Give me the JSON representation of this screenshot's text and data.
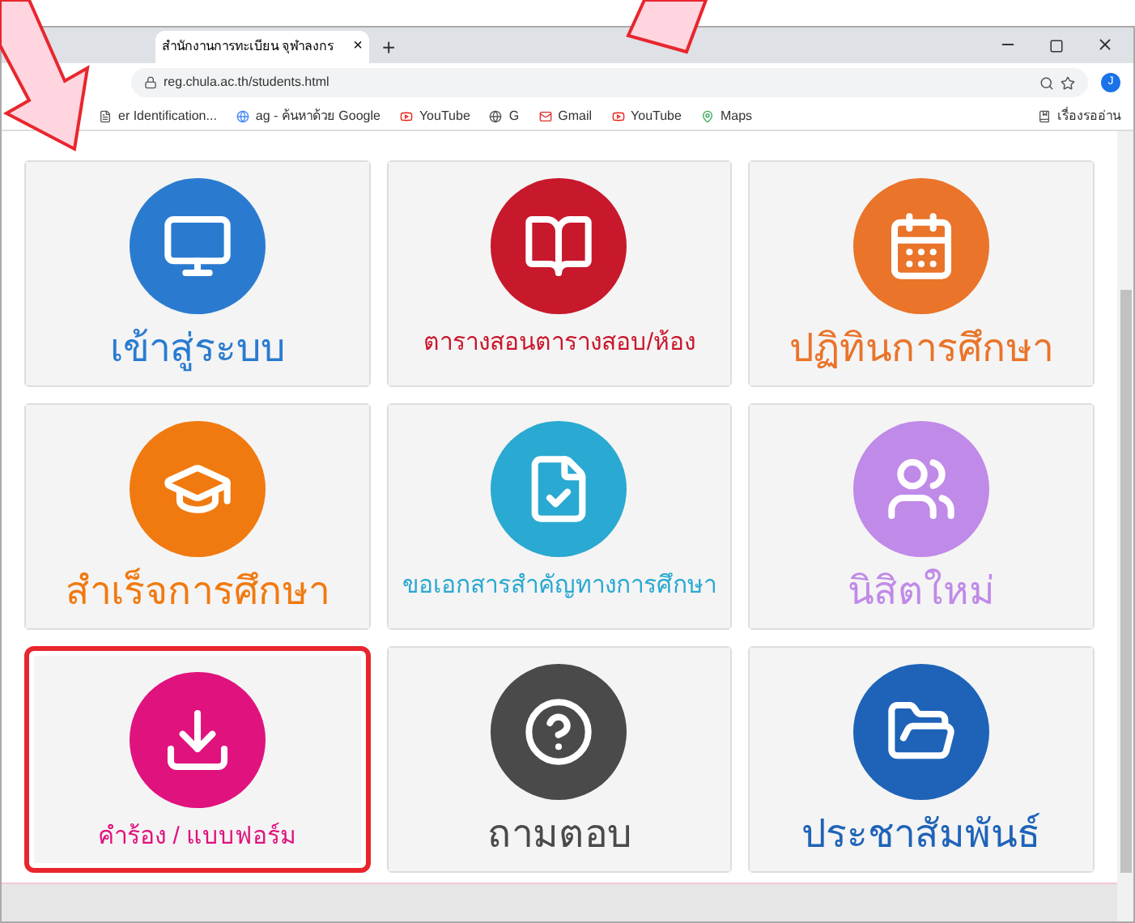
{
  "browser": {
    "tab": {
      "title": "สำนักงานการทะเบียน จุฬาลงกร",
      "close": "×"
    },
    "new_tab": "+",
    "address": "reg.chula.ac.th/students.html",
    "avatar": "J",
    "bookmarks": [
      {
        "label": "er Identification...",
        "kind": "page"
      },
      {
        "label": "ag - ค้นหาด้วย Google",
        "kind": "google"
      },
      {
        "label": "YouTube",
        "kind": "youtube"
      },
      {
        "label": "G",
        "kind": "globe"
      },
      {
        "label": "Gmail",
        "kind": "gmail"
      },
      {
        "label": "YouTube",
        "kind": "youtube"
      },
      {
        "label": "Maps",
        "kind": "maps"
      }
    ],
    "reading_list": "เรื่องรออ่าน"
  },
  "cards": [
    {
      "label": "เข้าสู่ระบบ",
      "kind": "monitor",
      "color": "#2a7bd0",
      "highlighted": false
    },
    {
      "label": "ตารางสอนตารางสอบ/ห้อง",
      "kind": "book",
      "color": "#c8182c",
      "highlighted": false
    },
    {
      "label": "ปฏิทินการศึกษา",
      "kind": "calendar",
      "color": "#e9742a",
      "highlighted": false
    },
    {
      "label": "สำเร็จการศึกษา",
      "kind": "graduation",
      "color": "#f07a10",
      "highlighted": false
    },
    {
      "label": "ขอเอกสารสำคัญทางการศึกษา",
      "kind": "document",
      "color": "#2aa9d2",
      "highlighted": false
    },
    {
      "label": "นิสิตใหม่",
      "kind": "students",
      "color": "#c08ae8",
      "highlighted": false
    },
    {
      "label": "คำร้อง / แบบฟอร์ม",
      "kind": "download",
      "color": "#e0127e",
      "highlighted": true
    },
    {
      "label": "ถามตอบ",
      "kind": "question",
      "color": "#4a4a4a",
      "highlighted": false
    },
    {
      "label": "ประชาสัมพันธ์",
      "kind": "folder",
      "color": "#1e63b8",
      "highlighted": false
    }
  ]
}
